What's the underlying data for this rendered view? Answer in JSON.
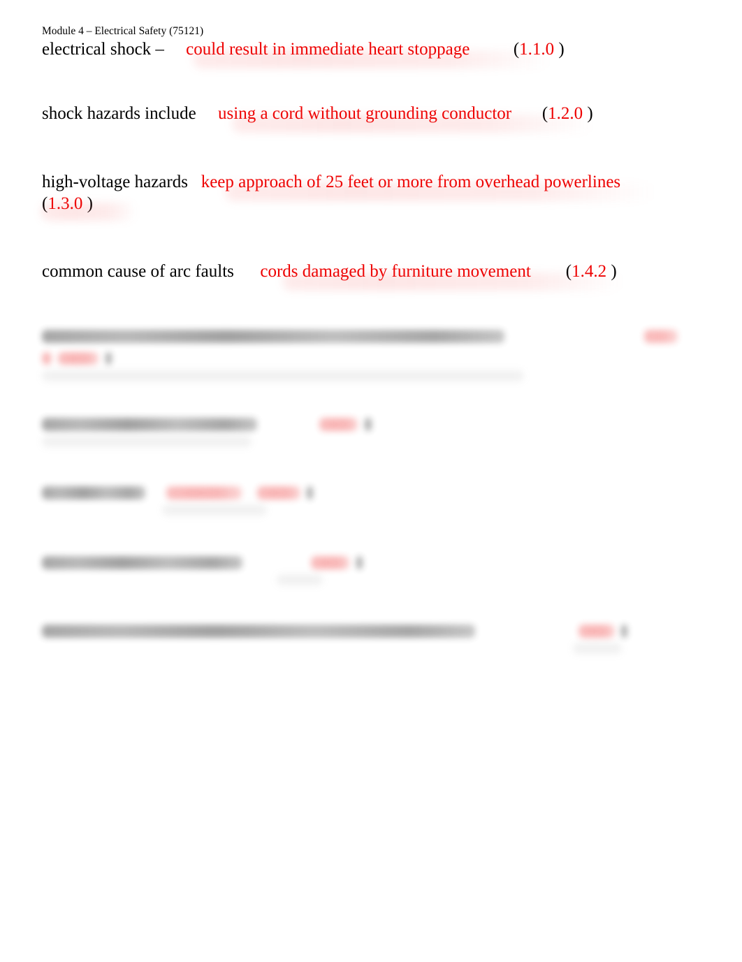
{
  "document": {
    "header": "Module 4 – Electrical Safety (75121)",
    "colors": {
      "answer_red": "#ee0000",
      "prompt_black": "#000000",
      "page_background": "#ffffff"
    }
  },
  "rows": [
    {
      "prompt": "electrical shock –",
      "answer": "could result in immediate heart stoppage",
      "ref_open": "(",
      "ref_number": "1.1.0",
      "ref_close": " )",
      "redacted": false
    },
    {
      "prompt": "shock hazards include",
      "answer": "using a cord without grounding conductor",
      "ref_open": "(",
      "ref_number": "1.2.0",
      "ref_close": " )",
      "redacted": false
    },
    {
      "prompt": "high-voltage hazards",
      "answer": "keep approach of 25 feet or more from overhead powerlines",
      "ref_open": "(",
      "ref_number": "1.3.0",
      "ref_close": " )",
      "redacted": false
    },
    {
      "prompt": "common cause of arc faults",
      "answer": "cords damaged by furniture movement",
      "ref_open": "(",
      "ref_number": "1.4.2",
      "ref_close": " )",
      "redacted": false
    },
    {
      "prompt": "",
      "answer": "",
      "ref_open": "",
      "ref_number": "",
      "ref_close": "",
      "redacted": true,
      "note": "illegible – blurred"
    },
    {
      "prompt": "",
      "answer": "",
      "ref_open": "",
      "ref_number": "",
      "ref_close": "",
      "redacted": true,
      "note": "illegible – blurred"
    },
    {
      "prompt": "",
      "answer": "",
      "ref_open": "",
      "ref_number": "",
      "ref_close": "",
      "redacted": true,
      "note": "illegible – blurred"
    },
    {
      "prompt": "",
      "answer": "",
      "ref_open": "",
      "ref_number": "",
      "ref_close": "",
      "redacted": true,
      "note": "illegible – blurred"
    },
    {
      "prompt": "",
      "answer": "",
      "ref_open": "",
      "ref_number": "",
      "ref_close": "",
      "redacted": true,
      "note": "illegible – blurred"
    }
  ]
}
